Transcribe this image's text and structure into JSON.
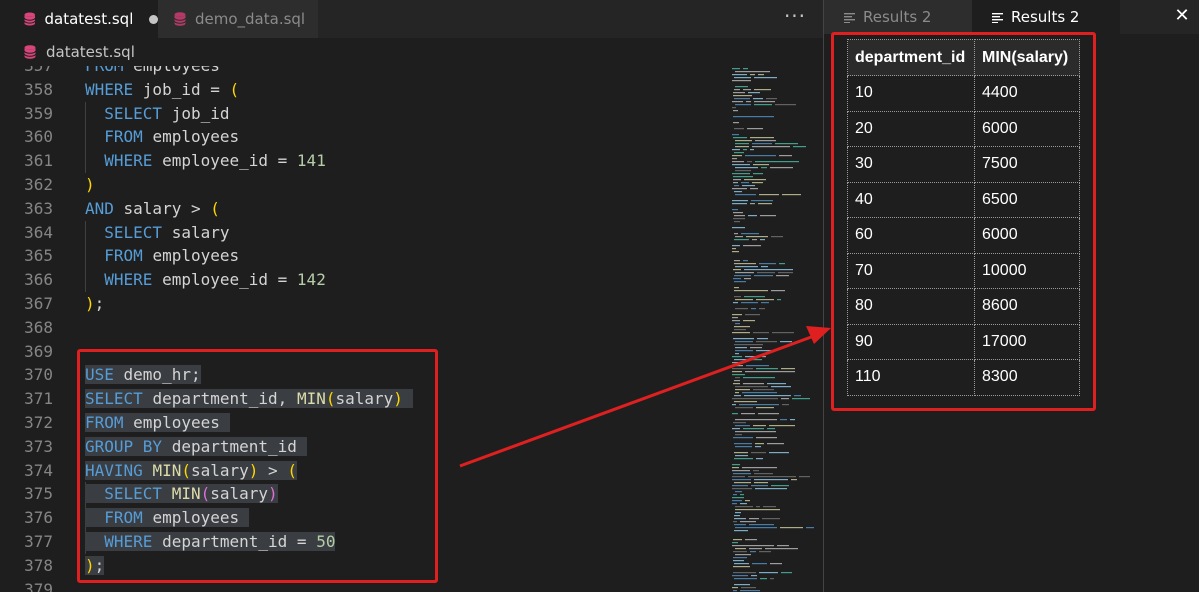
{
  "editor": {
    "tabs": [
      {
        "label": "datatest.sql",
        "active": true,
        "modified": true
      },
      {
        "label": "demo_data.sql",
        "active": false,
        "modified": false
      }
    ],
    "more_actions": "···",
    "breadcrumb": "datatest.sql",
    "lines": [
      {
        "num": "357",
        "tokens": [
          {
            "t": "FROM ",
            "c": "kw"
          },
          {
            "t": "employees",
            "c": "id"
          }
        ]
      },
      {
        "num": "358",
        "tokens": [
          {
            "t": "WHERE ",
            "c": "kw"
          },
          {
            "t": "job_id = ",
            "c": "id"
          },
          {
            "t": "(",
            "c": "p1"
          }
        ]
      },
      {
        "num": "359",
        "indent": true,
        "tokens": [
          {
            "t": "  SELECT ",
            "c": "kw"
          },
          {
            "t": "job_id",
            "c": "id"
          }
        ]
      },
      {
        "num": "360",
        "indent": true,
        "tokens": [
          {
            "t": "  FROM ",
            "c": "kw"
          },
          {
            "t": "employees",
            "c": "id"
          }
        ]
      },
      {
        "num": "361",
        "indent": true,
        "tokens": [
          {
            "t": "  WHERE ",
            "c": "kw"
          },
          {
            "t": "employee_id = ",
            "c": "id"
          },
          {
            "t": "141",
            "c": "num"
          }
        ]
      },
      {
        "num": "362",
        "tokens": [
          {
            "t": ")",
            "c": "p1"
          }
        ]
      },
      {
        "num": "363",
        "tokens": [
          {
            "t": "AND ",
            "c": "kw"
          },
          {
            "t": "salary > ",
            "c": "id"
          },
          {
            "t": "(",
            "c": "p1"
          }
        ]
      },
      {
        "num": "364",
        "indent": true,
        "tokens": [
          {
            "t": "  SELECT ",
            "c": "kw"
          },
          {
            "t": "salary",
            "c": "id"
          }
        ]
      },
      {
        "num": "365",
        "indent": true,
        "tokens": [
          {
            "t": "  FROM ",
            "c": "kw"
          },
          {
            "t": "employees",
            "c": "id"
          }
        ]
      },
      {
        "num": "366",
        "indent": true,
        "tokens": [
          {
            "t": "  WHERE ",
            "c": "kw"
          },
          {
            "t": "employee_id = ",
            "c": "id"
          },
          {
            "t": "142",
            "c": "num"
          }
        ]
      },
      {
        "num": "367",
        "tokens": [
          {
            "t": ")",
            "c": "p1"
          },
          {
            "t": ";",
            "c": "id"
          }
        ]
      },
      {
        "num": "368",
        "tokens": []
      },
      {
        "num": "369",
        "tokens": []
      },
      {
        "num": "370",
        "sel": true,
        "tokens": [
          {
            "t": "USE ",
            "c": "kw"
          },
          {
            "t": "demo_hr;",
            "c": "id"
          }
        ]
      },
      {
        "num": "371",
        "sel": true,
        "tokens": [
          {
            "t": "SELECT ",
            "c": "kw"
          },
          {
            "t": "department_id, ",
            "c": "id"
          },
          {
            "t": "MIN",
            "c": "fn"
          },
          {
            "t": "(",
            "c": "p1"
          },
          {
            "t": "salary",
            "c": "id"
          },
          {
            "t": ")",
            "c": "p1"
          },
          {
            "t": " ",
            "c": "id"
          }
        ]
      },
      {
        "num": "372",
        "sel": true,
        "tokens": [
          {
            "t": "FROM ",
            "c": "kw"
          },
          {
            "t": "employees ",
            "c": "id"
          }
        ]
      },
      {
        "num": "373",
        "sel": true,
        "tokens": [
          {
            "t": "GROUP BY ",
            "c": "kw"
          },
          {
            "t": "department_id ",
            "c": "id"
          }
        ]
      },
      {
        "num": "374",
        "sel": true,
        "tokens": [
          {
            "t": "HAVING ",
            "c": "kw"
          },
          {
            "t": "MIN",
            "c": "fn"
          },
          {
            "t": "(",
            "c": "p1"
          },
          {
            "t": "salary",
            "c": "id"
          },
          {
            "t": ")",
            "c": "p1"
          },
          {
            "t": " > ",
            "c": "id"
          },
          {
            "t": "(",
            "c": "p1"
          }
        ]
      },
      {
        "num": "375",
        "sel": true,
        "indent": true,
        "tokens": [
          {
            "t": "  SELECT ",
            "c": "kw"
          },
          {
            "t": "MIN",
            "c": "fn"
          },
          {
            "t": "(",
            "c": "p2"
          },
          {
            "t": "salary",
            "c": "id"
          },
          {
            "t": ")",
            "c": "p2"
          }
        ]
      },
      {
        "num": "376",
        "sel": true,
        "indent": true,
        "tokens": [
          {
            "t": "  FROM ",
            "c": "kw"
          },
          {
            "t": "employees ",
            "c": "id"
          }
        ]
      },
      {
        "num": "377",
        "sel": true,
        "indent": true,
        "tokens": [
          {
            "t": "  WHERE ",
            "c": "kw"
          },
          {
            "t": "department_id = ",
            "c": "id"
          },
          {
            "t": "50",
            "c": "num"
          }
        ]
      },
      {
        "num": "378",
        "sel": true,
        "tokens": [
          {
            "t": ")",
            "c": "p1"
          },
          {
            "t": ";",
            "c": "id"
          }
        ]
      },
      {
        "num": "379",
        "tokens": []
      }
    ]
  },
  "results": {
    "tabs": [
      {
        "label": "Results 2",
        "active": false
      },
      {
        "label": "Results 2",
        "active": true
      }
    ],
    "close_label": "✕",
    "columns": [
      "department_id",
      "MIN(salary)"
    ],
    "rows": [
      [
        "10",
        "4400"
      ],
      [
        "20",
        "6000"
      ],
      [
        "30",
        "7500"
      ],
      [
        "40",
        "6500"
      ],
      [
        "60",
        "6000"
      ],
      [
        "70",
        "10000"
      ],
      [
        "80",
        "8600"
      ],
      [
        "90",
        "17000"
      ],
      [
        "110",
        "8300"
      ]
    ]
  },
  "icons": {
    "sql_file": "database-icon",
    "results_tab": "list-icon",
    "close": "close-icon",
    "more": "ellipsis-icon"
  },
  "colors": {
    "annotation": "#e02020",
    "keyword": "#569cd6",
    "function": "#dcdcaa",
    "number": "#b5cea8",
    "bracket_1": "#ffd700",
    "bracket_2": "#da70d6",
    "sql_icon": "#d7457a"
  }
}
